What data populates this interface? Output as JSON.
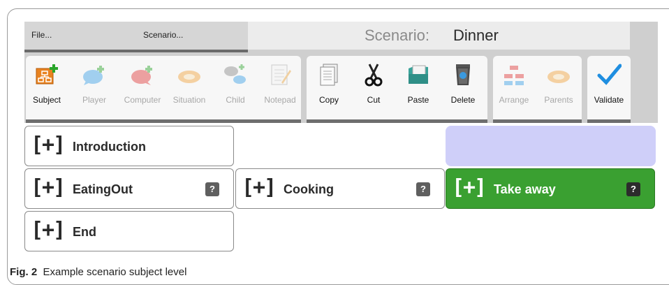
{
  "menu": {
    "file": "File...",
    "scenario": "Scenario..."
  },
  "title": {
    "label": "Scenario:",
    "value": "Dinner"
  },
  "toolbar": {
    "subject": "Subject",
    "player": "Player",
    "computer": "Computer",
    "situation": "Situation",
    "child": "Child",
    "notepad": "Notepad",
    "copy": "Copy",
    "cut": "Cut",
    "paste": "Paste",
    "delete": "Delete",
    "arrange": "Arrange",
    "parents": "Parents",
    "validate": "Validate"
  },
  "nodes": {
    "introduction": {
      "expander": "[+]",
      "label": "Introduction"
    },
    "eatingout": {
      "expander": "[+]",
      "label": "EatingOut",
      "help": "?"
    },
    "cooking": {
      "expander": "[+]",
      "label": "Cooking",
      "help": "?"
    },
    "takeaway": {
      "expander": "[+]",
      "label": "Take away",
      "help": "?"
    },
    "end": {
      "expander": "[+]",
      "label": "End"
    }
  },
  "colors": {
    "selected_node": "#3aa031",
    "placeholder": "#cfcff9"
  },
  "caption": {
    "fig": "Fig. 2",
    "text": "Example scenario subject level"
  }
}
